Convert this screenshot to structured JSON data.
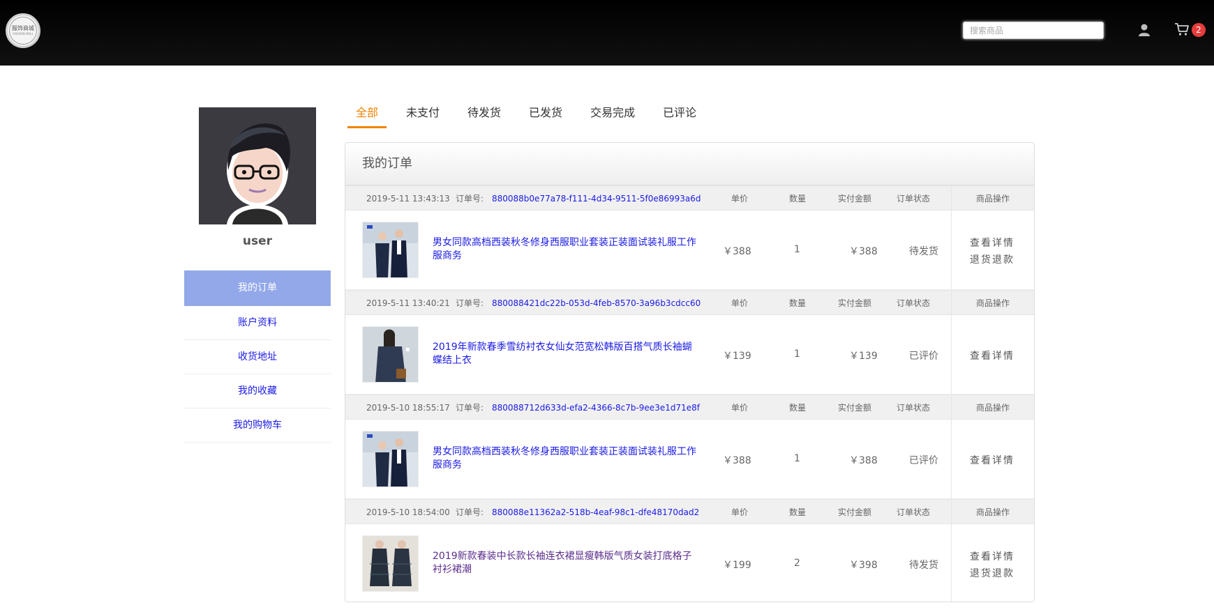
{
  "header": {
    "logo_text": "服饰商城",
    "logo_subtext": "FASHION MALL",
    "search_placeholder": "搜索商品",
    "cart_count": "2"
  },
  "sidebar": {
    "username": "user",
    "items": [
      {
        "label": "我的订单",
        "active": true
      },
      {
        "label": "账户资料"
      },
      {
        "label": "收货地址"
      },
      {
        "label": "我的收藏"
      },
      {
        "label": "我的购物车"
      }
    ]
  },
  "tabs": [
    {
      "label": "全部",
      "active": true
    },
    {
      "label": "未支付"
    },
    {
      "label": "待发货"
    },
    {
      "label": "已发货"
    },
    {
      "label": "交易完成"
    },
    {
      "label": "已评论"
    }
  ],
  "orders_panel": {
    "title": "我的订单",
    "columns": {
      "order_no_label": "订单号:",
      "unit_price": "单价",
      "quantity": "数量",
      "paid_amount": "实付金额",
      "status": "订单状态",
      "operations": "商品操作"
    },
    "orders": [
      {
        "time": "2019-5-11 13:43:13",
        "order_no": "880088b0e77a78-f111-4d34-9511-5f0e86993a6d",
        "product_name": "男女同款高档西装秋冬修身西服职业套装正装面试装礼服工作服商务",
        "price": "￥388",
        "quantity": "1",
        "paid": "￥388",
        "status": "待发货",
        "actions": [
          "查看详情",
          "退货退款"
        ]
      },
      {
        "time": "2019-5-11 13:40:21",
        "order_no": "880088421dc22b-053d-4feb-8570-3a96b3cdcc60",
        "product_name": "2019年新款春季雪纺衬衣女仙女范宽松韩版百搭气质长袖蝴蝶结上衣",
        "price": "￥139",
        "quantity": "1",
        "paid": "￥139",
        "status": "已评价",
        "actions": [
          "查看详情"
        ]
      },
      {
        "time": "2019-5-10 18:55:17",
        "order_no": "880088712d633d-efa2-4366-8c7b-9ee3e1d71e8f",
        "product_name": "男女同款高档西装秋冬修身西服职业套装正装面试装礼服工作服商务",
        "price": "￥388",
        "quantity": "1",
        "paid": "￥388",
        "status": "已评价",
        "actions": [
          "查看详情"
        ]
      },
      {
        "time": "2019-5-10 18:54:00",
        "order_no": "880088e11362a2-518b-4eaf-98c1-dfe48170dad2",
        "product_name": "2019新款春装中长款长袖连衣裙显瘦韩版气质女装打底格子衬衫裙潮",
        "price": "￥199",
        "quantity": "2",
        "paid": "￥398",
        "status": "待发货",
        "actions": [
          "查看详情",
          "退货退款"
        ]
      }
    ]
  },
  "colors": {
    "header_bg": "#000000",
    "accent": "#f08300",
    "sidebar_active": "#93a8e9",
    "link": "#1a1ae6",
    "badge": "#e63d3d"
  },
  "icons": [
    "user-icon",
    "shopping-cart-icon"
  ]
}
